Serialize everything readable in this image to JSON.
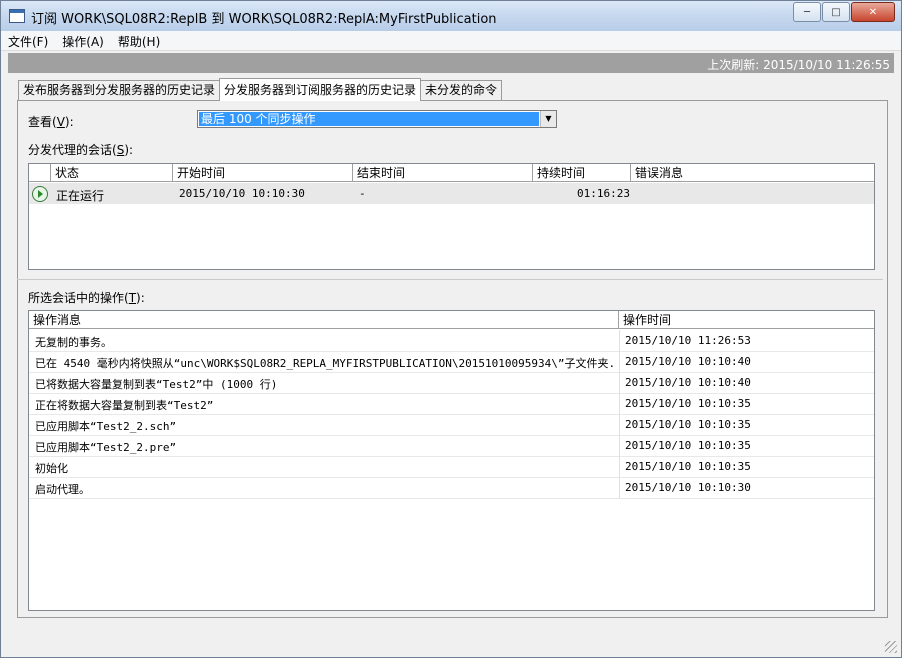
{
  "window": {
    "title": "订阅 WORK\\SQL08R2:ReplB 到 WORK\\SQL08R2:ReplA:MyFirstPublication"
  },
  "menu": [
    "文件(F)",
    "操作(A)",
    "帮助(H)"
  ],
  "refresh": "上次刷新: 2015/10/10 11:26:55",
  "tabs": [
    "发布服务器到分发服务器的历史记录",
    "分发服务器到订阅服务器的历史记录",
    "未分发的命令"
  ],
  "view": {
    "label_pre": "查看(",
    "label_key": "V",
    "label_post": "):",
    "value": "最后 100 个同步操作"
  },
  "sessions": {
    "label_pre": "分发代理的会话(",
    "label_key": "S",
    "label_post": "):",
    "columns": [
      "状态",
      "开始时间",
      "结束时间",
      "持续时间",
      "错误消息"
    ],
    "rows": [
      {
        "status": "正在运行",
        "start": "2015/10/10 10:10:30",
        "end": "-",
        "duration": "01:16:23",
        "error": ""
      }
    ]
  },
  "actions": {
    "label_pre": "所选会话中的操作(",
    "label_key": "T",
    "label_post": "):",
    "columns": [
      "操作消息",
      "操作时间"
    ],
    "rows": [
      {
        "message": "无复制的事务。",
        "time": "2015/10/10 11:26:53"
      },
      {
        "message": "已在 4540 毫秒内将快照从“unc\\WORK$SQL08R2_REPLA_MYFIRSTPUBLICATION\\20151010095934\\”子文件夹...",
        "time": "2015/10/10 10:10:40"
      },
      {
        "message": "已将数据大容量复制到表“Test2”中 (1000 行)",
        "time": "2015/10/10 10:10:40"
      },
      {
        "message": "正在将数据大容量复制到表“Test2”",
        "time": "2015/10/10 10:10:35"
      },
      {
        "message": "已应用脚本“Test2_2.sch”",
        "time": "2015/10/10 10:10:35"
      },
      {
        "message": "已应用脚本“Test2_2.pre”",
        "time": "2015/10/10 10:10:35"
      },
      {
        "message": "初始化",
        "time": "2015/10/10 10:10:35"
      },
      {
        "message": "启动代理。",
        "time": "2015/10/10 10:10:30"
      }
    ]
  }
}
